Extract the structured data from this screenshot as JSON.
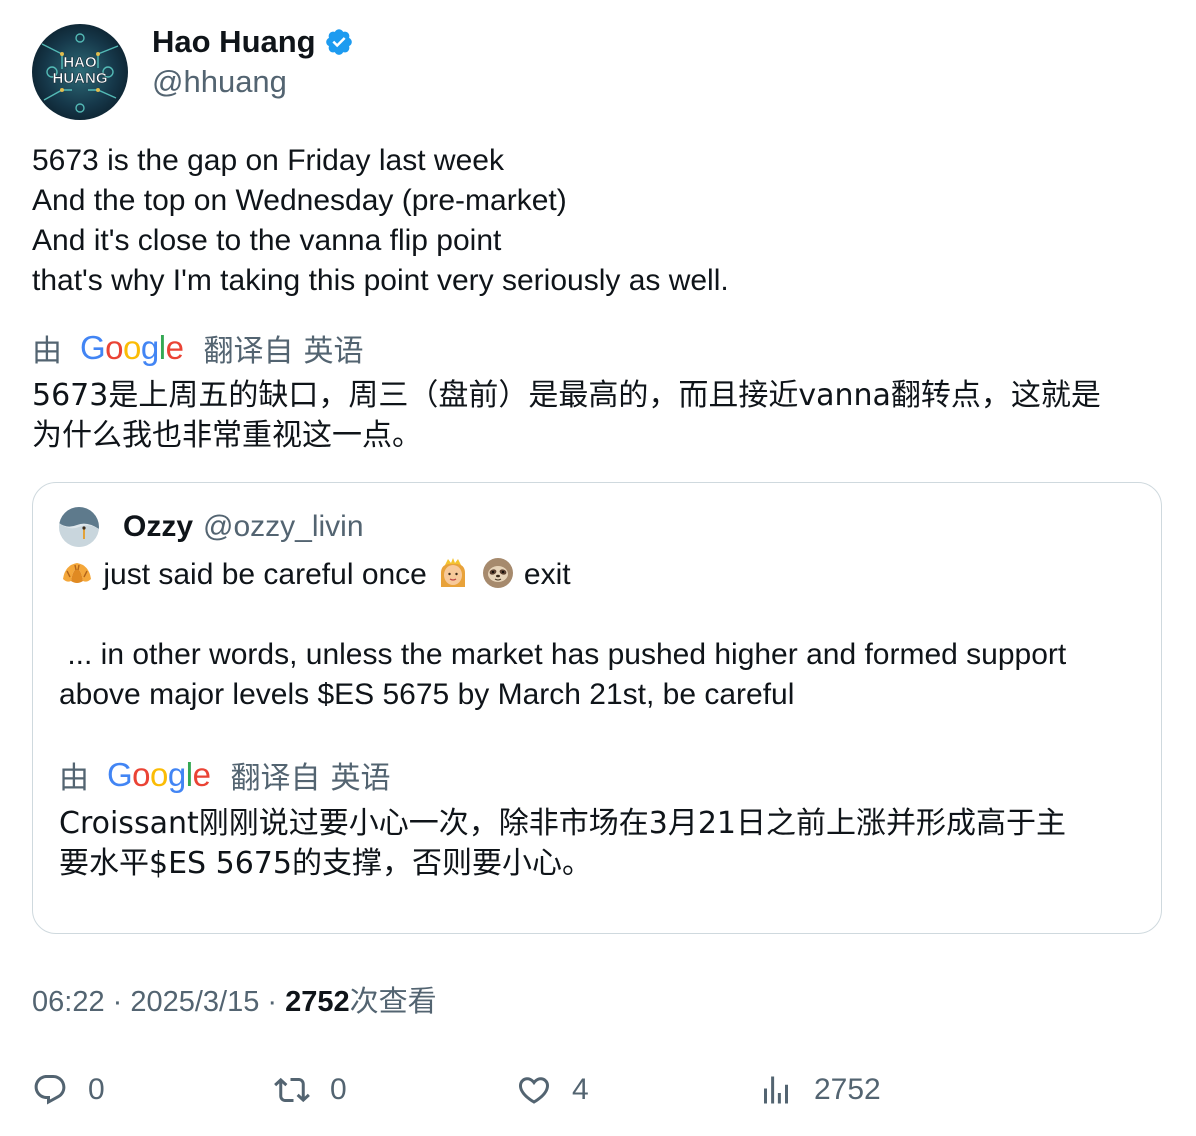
{
  "author": {
    "name": "Hao Huang",
    "handle": "@hhuang",
    "avatar_text_1": "HAO",
    "avatar_text_2": "HUANG"
  },
  "tweet": {
    "lines": [
      "5673 is the gap on Friday last week",
      "And the top on Wednesday (pre-market)",
      "And it's close to the vanna flip point",
      "that's why I'm taking this point very seriously as well."
    ],
    "translation": {
      "by": "由",
      "google": "Google",
      "from": "翻译自",
      "language": "英语",
      "lines": [
        "5673是上周五的缺口，周三（盘前）是最高的，而且接近vanna翻转点，这就是",
        "为什么我也非常重视这一点。"
      ]
    }
  },
  "quote": {
    "name": "Ozzy",
    "handle": "@ozzy_livin",
    "line1_a": "just said be careful once",
    "line1_b": "exit",
    "line2": " ... in other words, unless the market has pushed higher and formed support",
    "line3": "above major levels $ES 5675 by March 21st, be careful",
    "translation": {
      "by": "由",
      "google": "Google",
      "from": "翻译自",
      "language": "英语",
      "lines": [
        "Croissant刚刚说过要小心一次，除非市场在3月21日之前上涨并形成高于主",
        "要水平$ES 5675的支撑，否则要小心。"
      ]
    },
    "emojis": [
      "croissant-emoji",
      "princess-emoji",
      "sloth-emoji"
    ]
  },
  "meta": {
    "time": "06:22",
    "sep1": " · ",
    "date": "2025/3/15",
    "sep2": " · ",
    "views": "2752",
    "views_label": "次查看"
  },
  "actions": {
    "reply_count": "0",
    "retweet_count": "0",
    "like_count": "4",
    "views_count": "2752"
  },
  "colors": {
    "text_primary": "#0f1419",
    "text_secondary": "#536471",
    "verified": "#1d9bf0",
    "border": "#cfd9de"
  }
}
